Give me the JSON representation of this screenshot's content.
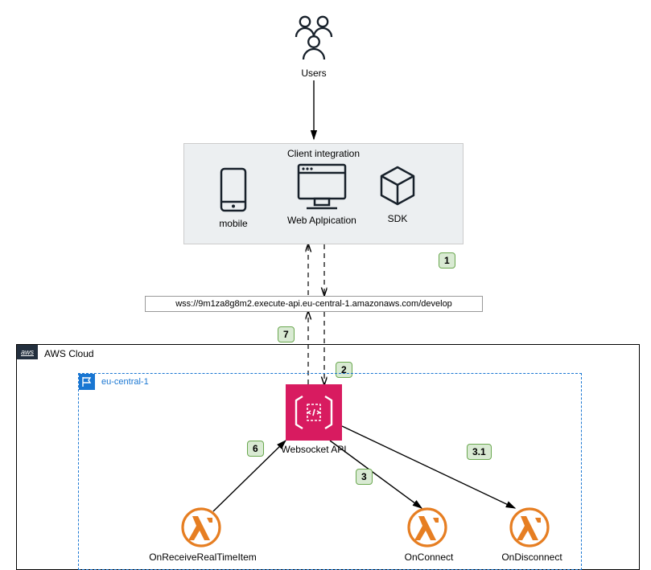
{
  "users": {
    "label": "Users"
  },
  "clientIntegration": {
    "title": "Client integration",
    "mobile": "mobile",
    "web": "Web Aplpication",
    "sdk": "SDK"
  },
  "urlBox": "wss://9m1za8g8m2.execute-api.eu-central-1.amazonaws.com/develop",
  "awsCloud": {
    "badge": "aws",
    "label": "AWS Cloud"
  },
  "region": {
    "label": "eu-central-1"
  },
  "websocketApi": {
    "label": "Websocket API"
  },
  "lambdas": {
    "onReceive": "OnReceiveRealTimeItem",
    "onConnect": "OnConnect",
    "onDisconnect": "OnDisconnect"
  },
  "steps": {
    "s1": "1",
    "s2": "2",
    "s3": "3",
    "s31": "3.1",
    "s6": "6",
    "s7": "7"
  }
}
